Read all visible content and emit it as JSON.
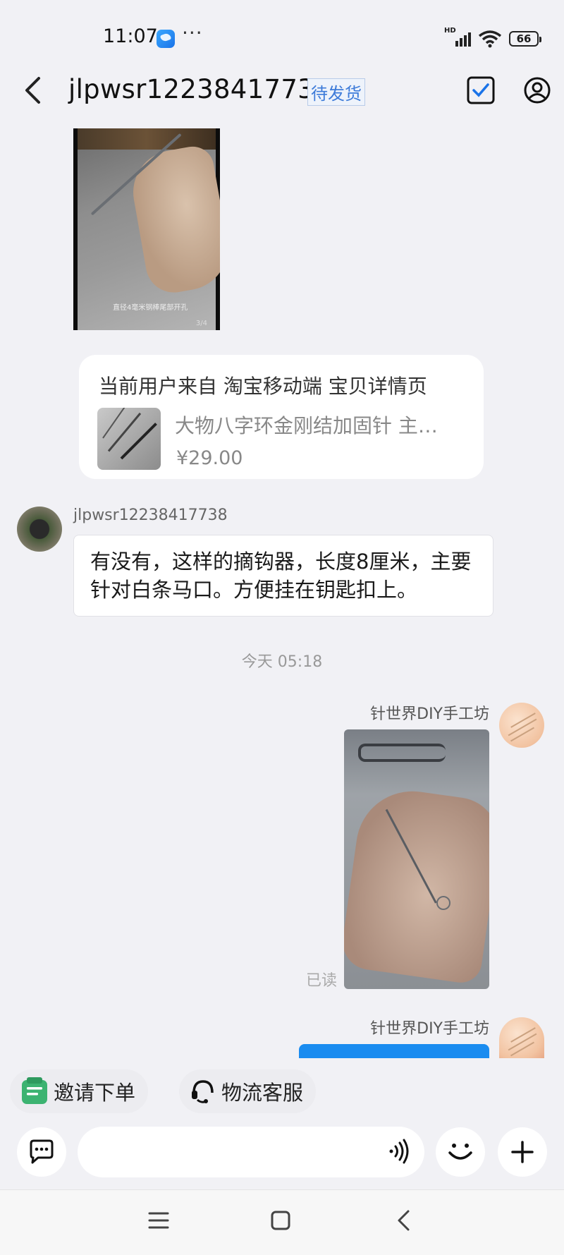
{
  "status_bar": {
    "time": "11:07",
    "more": "···",
    "network": "HD",
    "battery": "66"
  },
  "header": {
    "title": "jlpwsr12238417738",
    "order_status": "待发货"
  },
  "messages": {
    "image1": {
      "caption": "直径4毫米钢棒尾部开孔",
      "pager": "3/4"
    },
    "product_card": {
      "source": "当前用户来自 淘宝移动端 宝贝详情页",
      "name": "大物八字环金刚结加固针 主…",
      "price": "¥29.00"
    },
    "incoming": {
      "sender": "jlpwsr12238417738",
      "text": "有没有，这样的摘钩器，长度8厘米，主要针对白条马口。方便挂在钥匙扣上。"
    },
    "timestamp": "今天  05:18",
    "outgoing": {
      "sender": "针世界DIY手工坊",
      "read_status": "已读",
      "sender2": "针世界DIY手工坊"
    }
  },
  "quick_actions": {
    "invite_label": "邀请下单",
    "logistics_label": "物流客服"
  },
  "input": {
    "placeholder": ""
  },
  "colors": {
    "accent_blue": "#1a8cf0",
    "badge_blue": "#3d7bd9",
    "background": "#f1f1f5",
    "invite_green": "#3cb371"
  }
}
